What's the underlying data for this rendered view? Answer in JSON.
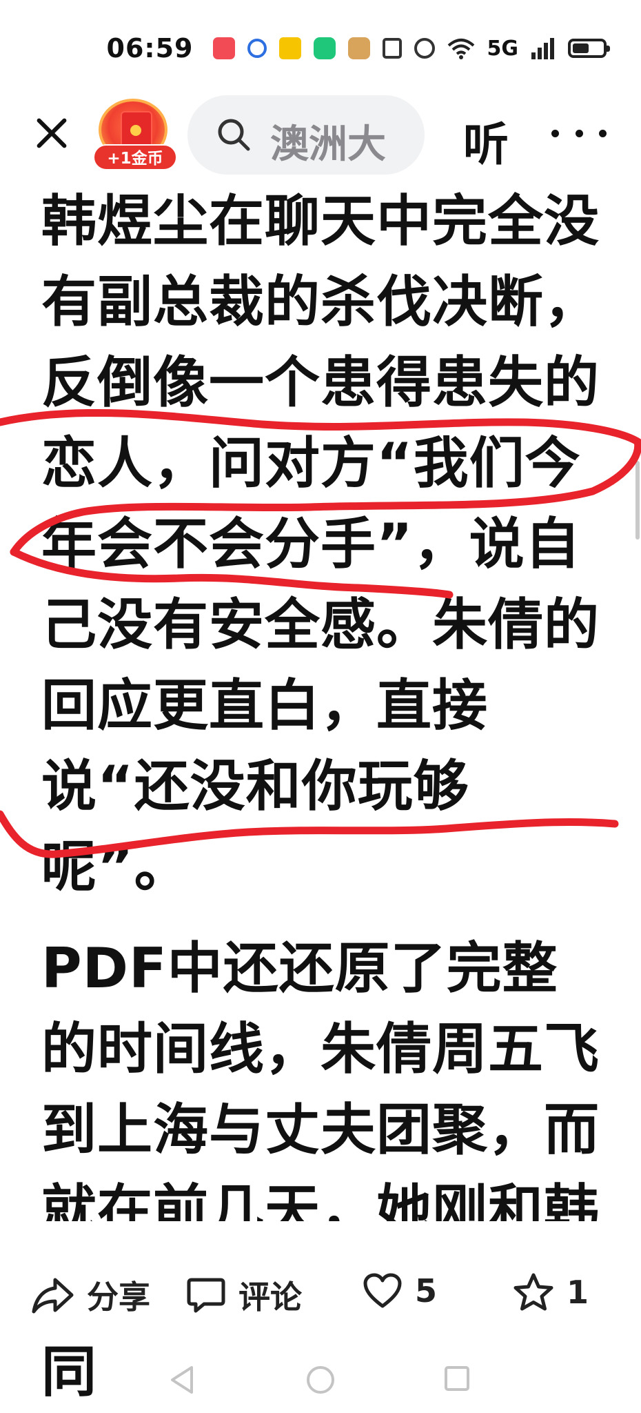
{
  "status_bar": {
    "time": "06:59",
    "network": "5G",
    "battery_level": 0.55
  },
  "top_bar": {
    "coin_badge": "+1金币",
    "search_query": "澳洲大",
    "listen_label": "听"
  },
  "article": {
    "paragraph_1": "韩煜尘在聊天中完全没有副总裁的杀伐决断，反倒像一个患得患失的恋人，问对方“我们今年会不会分手”，说自己没有安全感。朱倩的回应更直白，直接说“还没和你玩够呢”。",
    "paragraph_2": "PDF中还还原了完整的时间线，朱倩周五飞到上海与丈夫团聚，而就在前几天，她刚和韩煜尘在外地酒店见过面同"
  },
  "actions": {
    "share_label": "分享",
    "comment_label": "评论",
    "like_count": "5",
    "favorite_count": "1"
  },
  "colors": {
    "annotation_red": "#e8232b",
    "badge_red": "#e8332d",
    "search_bg": "#f1f2f4"
  }
}
